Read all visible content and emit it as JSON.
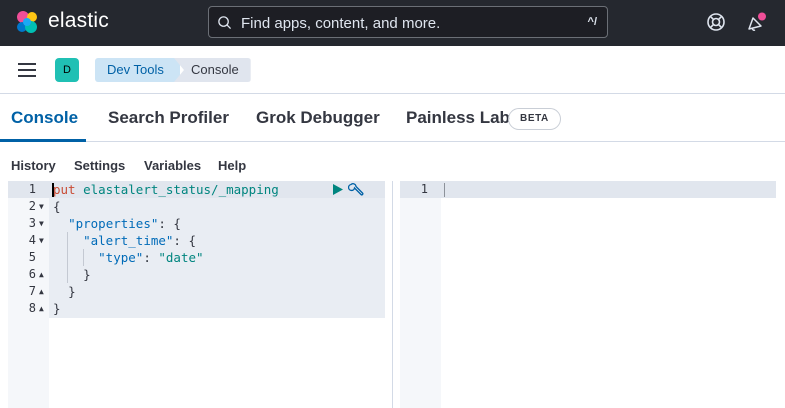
{
  "header": {
    "brand": "elastic",
    "search_placeholder": "Find apps, content, and more.",
    "search_shortcut": "^/",
    "help_icon": "lifebuoy-icon",
    "news_icon": "newsfeed-icon"
  },
  "nav": {
    "avatar": "D",
    "breadcrumbs": [
      "Dev Tools",
      "Console"
    ]
  },
  "tabs": [
    {
      "label": "Console",
      "active": true
    },
    {
      "label": "Search Profiler"
    },
    {
      "label": "Grok Debugger"
    },
    {
      "label": "Painless Lab",
      "badge": "BETA"
    }
  ],
  "submenu": [
    "History",
    "Settings",
    "Variables",
    "Help"
  ],
  "editor": {
    "lines": [
      {
        "n": "1",
        "fold": ""
      },
      {
        "n": "2",
        "fold": "▼"
      },
      {
        "n": "3",
        "fold": "▼"
      },
      {
        "n": "4",
        "fold": "▼"
      },
      {
        "n": "5",
        "fold": ""
      },
      {
        "n": "6",
        "fold": "▲"
      },
      {
        "n": "7",
        "fold": "▲"
      },
      {
        "n": "8",
        "fold": "▲"
      }
    ],
    "method": "put",
    "path": "elastalert_status/_mapping",
    "open_brace": "{",
    "close_brace": "}",
    "properties_key": "\"properties\"",
    "alert_time_key": "\"alert_time\"",
    "type_key": "\"type\"",
    "type_value": "\"date\"",
    "colon_brace": ": {",
    "colon": ": "
  },
  "output": {
    "line_number": "1"
  },
  "colors": {
    "header_bg": "#25282f",
    "accent": "#0061a6",
    "avatar": "#20c0b4",
    "run": "#00857f"
  }
}
